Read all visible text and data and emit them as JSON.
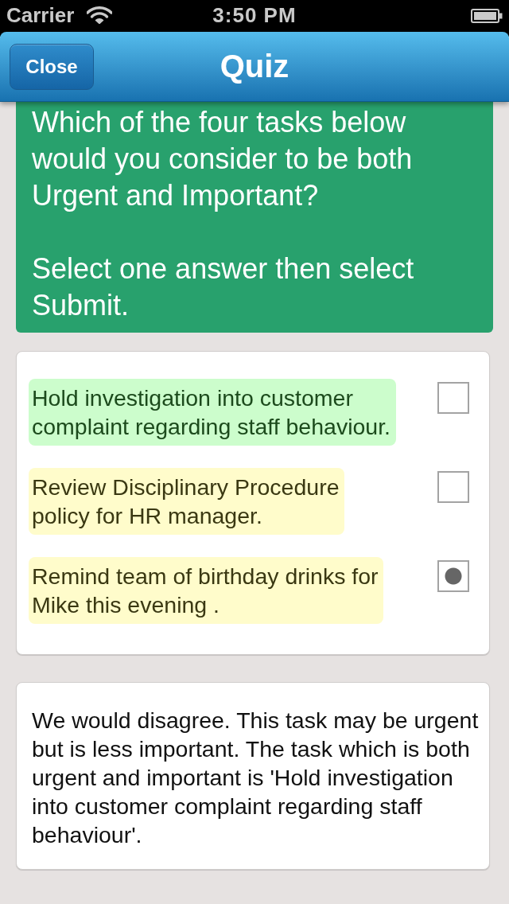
{
  "status_bar": {
    "carrier": "Carrier",
    "time": "3:50 PM"
  },
  "nav_bar": {
    "close_button": "Close",
    "title": "Quiz"
  },
  "question": {
    "paragraphs": [
      "Which of the four tasks below would you consider to be both Urgent and Important?",
      "Select one answer then select Submit."
    ]
  },
  "options": [
    {
      "text": "Hold investigation into customer complaint regarding staff behaviour.",
      "correct": true,
      "selected": false
    },
    {
      "text": "Review Disciplinary Procedure policy for HR manager.",
      "correct": false,
      "selected": false
    },
    {
      "text": "Remind team of birthday drinks for Mike this evening .",
      "correct": false,
      "selected": true
    }
  ],
  "feedback": {
    "text": "We would disagree. This task may be urgent but is less important. The task which is both urgent and important is 'Hold investigation into customer complaint regarding staff behaviour'."
  }
}
